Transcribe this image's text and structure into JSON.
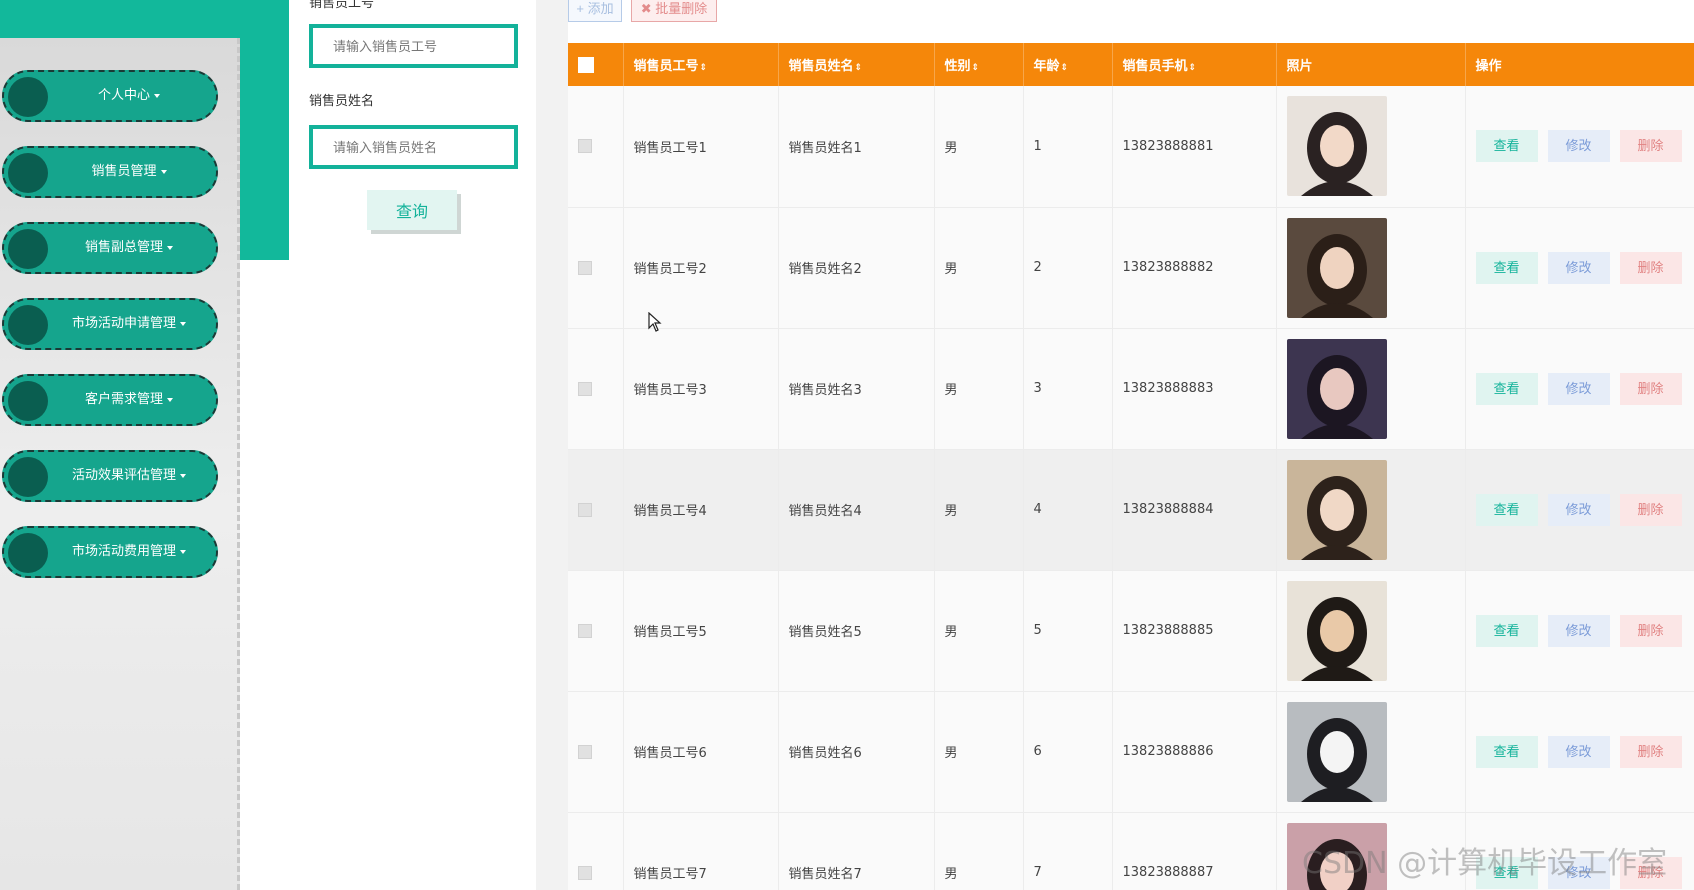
{
  "header": {
    "partial_text": ""
  },
  "sidebar": {
    "items": [
      {
        "label": "个人中心"
      },
      {
        "label": "销售员管理"
      },
      {
        "label": "销售副总管理"
      },
      {
        "label": "市场活动申请管理"
      },
      {
        "label": "客户需求管理"
      },
      {
        "label": "活动效果评估管理"
      },
      {
        "label": "市场活动费用管理"
      }
    ]
  },
  "search": {
    "field1_label": "销售员工号",
    "field1_placeholder": "请输入销售员工号",
    "field2_label": "销售员姓名",
    "field2_placeholder": "请输入销售员姓名",
    "query_label": "查询"
  },
  "toolbar": {
    "add_label": "添加",
    "batch_delete_label": "批量删除"
  },
  "table": {
    "headers": [
      "销售员工号",
      "销售员姓名",
      "性别",
      "年龄",
      "销售员手机",
      "照片",
      "操作"
    ],
    "sort_glyph": "⇕",
    "rows": [
      {
        "id": "销售员工号1",
        "name": "销售员姓名1",
        "gender": "男",
        "age": "1",
        "phone": "13823888881",
        "view": "查看",
        "edit": "修改",
        "delete": "删除"
      },
      {
        "id": "销售员工号2",
        "name": "销售员姓名2",
        "gender": "男",
        "age": "2",
        "phone": "13823888882",
        "view": "查看",
        "edit": "修改",
        "delete": "删除"
      },
      {
        "id": "销售员工号3",
        "name": "销售员姓名3",
        "gender": "男",
        "age": "3",
        "phone": "13823888883",
        "view": "查看",
        "edit": "修改",
        "delete": "删除"
      },
      {
        "id": "销售员工号4",
        "name": "销售员姓名4",
        "gender": "男",
        "age": "4",
        "phone": "13823888884",
        "view": "查看",
        "edit": "修改",
        "delete": "删除"
      },
      {
        "id": "销售员工号5",
        "name": "销售员姓名5",
        "gender": "男",
        "age": "5",
        "phone": "13823888885",
        "view": "查看",
        "edit": "修改",
        "delete": "删除"
      },
      {
        "id": "销售员工号6",
        "name": "销售员姓名6",
        "gender": "男",
        "age": "6",
        "phone": "13823888886",
        "view": "查看",
        "edit": "修改",
        "delete": "删除"
      },
      {
        "id": "销售员工号7",
        "name": "销售员姓名7",
        "gender": "男",
        "age": "7",
        "phone": "13823888887",
        "view": "查看",
        "edit": "修改",
        "delete": "删除"
      }
    ]
  },
  "watermark": "CSDN @计算机毕设工作室",
  "colors": {
    "primary_teal": "#13b29a",
    "header_orange": "#f5870a",
    "dark_dot": "#0a5e50"
  }
}
